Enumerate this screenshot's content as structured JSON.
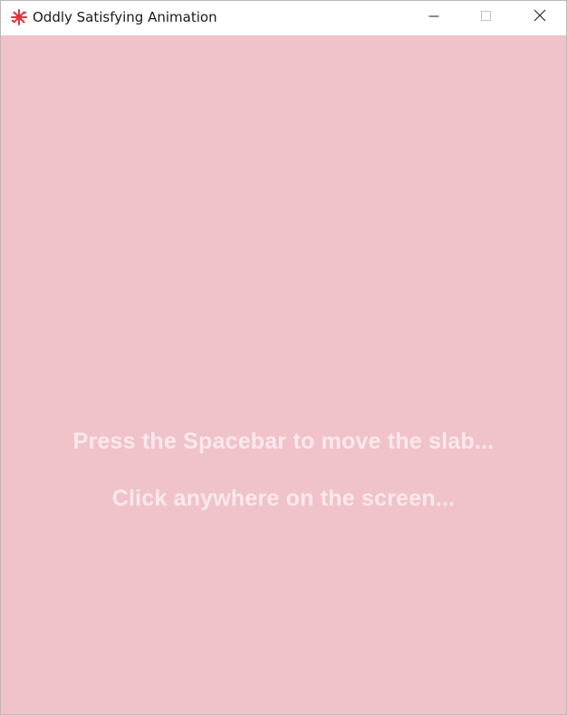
{
  "window": {
    "title": "Oddly Satisfying Animation",
    "icon": "red-splat-icon",
    "controls": {
      "minimize": "minimize-icon",
      "maximize": "maximize-icon",
      "close": "close-icon"
    }
  },
  "canvas": {
    "background_color": "#f0c2c9",
    "text_color": "#fbe9ec",
    "messages": {
      "spacebar": "Press the Spacebar to move the slab...",
      "click": "Click anywhere on the screen..."
    }
  }
}
